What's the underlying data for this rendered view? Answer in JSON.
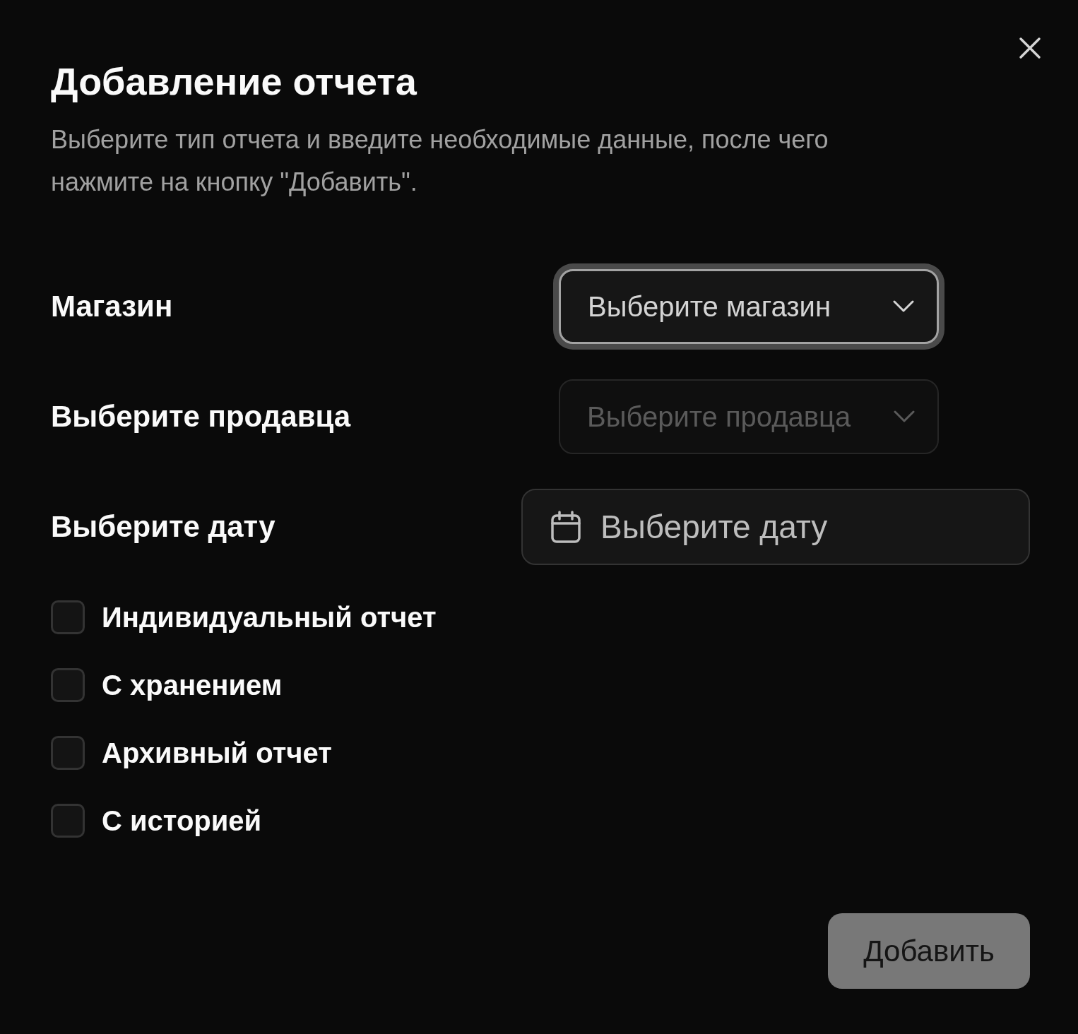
{
  "dialog": {
    "title": "Добавление отчета",
    "description": "Выберите тип отчета и введите необходимые данные, после чего нажмите на кнопку \"Добавить\".",
    "fields": [
      {
        "label": "Магазин",
        "kind": "select",
        "placeholder": "Выберите магазин",
        "focused": true,
        "disabled": false
      },
      {
        "label": "Выберите продавца",
        "kind": "select",
        "placeholder": "Выберите продавца",
        "focused": false,
        "disabled": true
      },
      {
        "label": "Выберите дату",
        "kind": "date",
        "placeholder": "Выберите дату"
      }
    ],
    "options": [
      {
        "label": "Индивидуальный отчет",
        "checked": false
      },
      {
        "label": "С хранением",
        "checked": false
      },
      {
        "label": "Архивный отчет",
        "checked": false
      },
      {
        "label": "С историей",
        "checked": false
      }
    ],
    "submit": {
      "label": "Добавить",
      "disabled": true
    }
  }
}
